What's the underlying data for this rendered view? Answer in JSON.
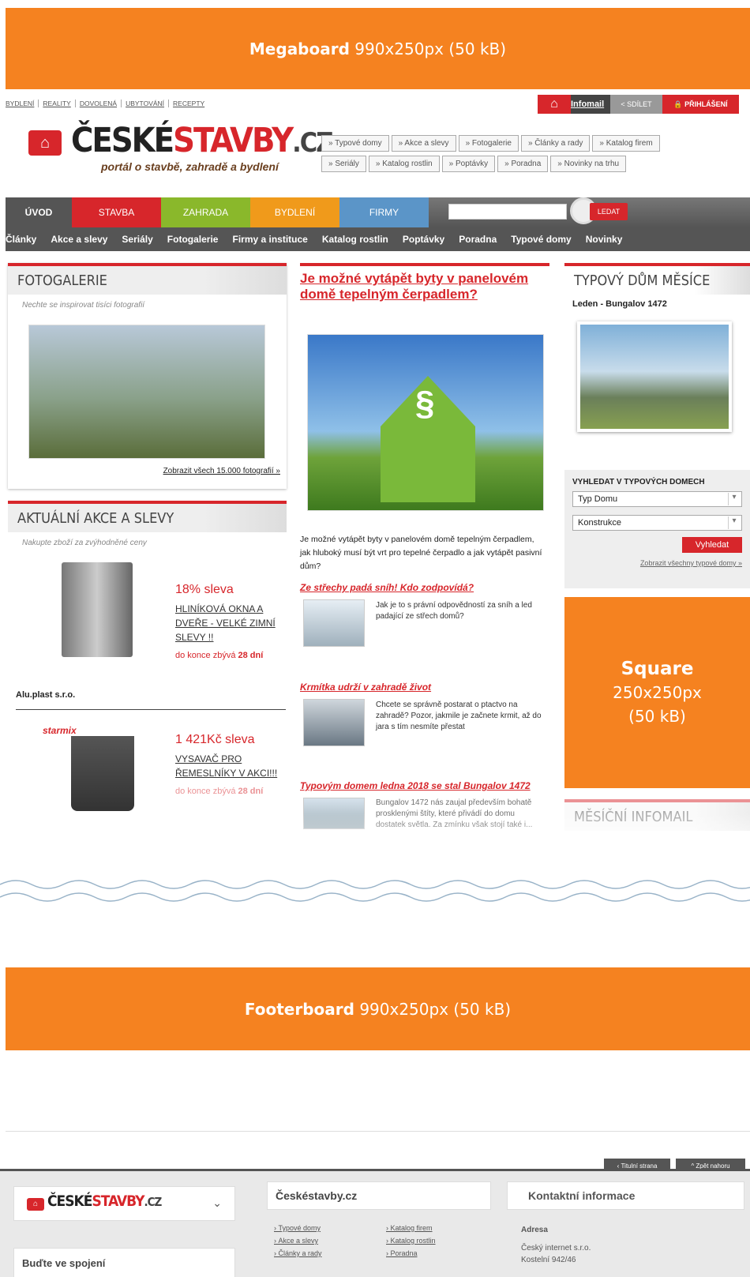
{
  "ads": {
    "mega": {
      "name": "Megaboard",
      "size": "990x250px (50 kB)"
    },
    "square": {
      "name": "Square",
      "size": "250x250px",
      "weight": "(50 kB)"
    },
    "foot": {
      "name": "Footerboard",
      "size": "990x250px (50 kB)"
    }
  },
  "toplinks": [
    "BYDLENÍ",
    "REALITY",
    "DOVOLENÁ",
    "UBYTOVÁNÍ",
    "RECEPTY"
  ],
  "topright": {
    "infomail": "Infomail",
    "share": "SDÍLET",
    "login": "PŘIHLÁŠENÍ"
  },
  "logo": {
    "a": "ČESKÉ",
    "b": "STAVBY",
    "c": ".CZ",
    "tagline": "portál o stavbě, zahradě a bydlení"
  },
  "quick": [
    "» Typové domy",
    "» Akce a slevy",
    "» Fotogalerie",
    "» Články a rady",
    "» Katalog firem",
    "» Seriály",
    "» Katalog rostlin",
    "» Poptávky",
    "» Poradna",
    "» Novinky na trhu"
  ],
  "mainnav": [
    {
      "label": "ÚVOD",
      "color": "#555555"
    },
    {
      "label": "STAVBA",
      "color": "#d7262b"
    },
    {
      "label": "ZAHRADA",
      "color": "#8ab82b"
    },
    {
      "label": "BYDLENÍ",
      "color": "#f09a1b"
    },
    {
      "label": "FIRMY",
      "color": "#5b95c8"
    }
  ],
  "search_button": "LEDAT",
  "subnav": [
    "Články",
    "Akce a slevy",
    "Seriály",
    "Fotogalerie",
    "Firmy a instituce",
    "Katalog rostlin",
    "Poptávky",
    "Poradna",
    "Typové domy",
    "Novinky"
  ],
  "gallery": {
    "title": "FOTOGALERIE",
    "sub": "Nechte se inspirovat tisíci fotografií",
    "link": "Zobrazit všech 15.000 fotografií »"
  },
  "deals": {
    "title": "AKTUÁLNÍ AKCE A SLEVY",
    "sub": "Nakupte zboží za zvýhodněné ceny",
    "items": [
      {
        "discount": "18% sleva",
        "name": "HLINÍKOVÁ OKNA A DVEŘE - VELKÉ ZIMNÍ SLEVY !!",
        "remaining": "do konce zbývá",
        "days": "28 dní",
        "company": "Alu.plast s.r.o."
      },
      {
        "discount": "1 421Kč sleva",
        "name": "VYSAVAČ PRO ŘEMESLNÍKY V AKCI!!!",
        "remaining": "do konce zbývá",
        "days": "28 dní",
        "brand": "starmix"
      }
    ]
  },
  "center": {
    "headline": "Je možné vytápět byty v panelovém domě tepelným čerpadlem?",
    "lead": "Je možné vytápět byty v panelovém domě tepelným čerpadlem, jak hluboký musí být vrt pro tepelné čerpadlo a jak vytápět pasivní dům?",
    "articles": [
      {
        "title": "Ze střechy padá sníh! Kdo zodpovídá?",
        "text": "Jak je to s právní odpovědností za sníh a led padající ze střech domů?"
      },
      {
        "title": "Krmítka udrží v zahradě život",
        "text": "Chcete se správně postarat o ptactvo na zahradě? Pozor, jakmile je začnete krmit, až do jara s tím nesmíte přestat"
      },
      {
        "title": "Typovým domem ledna 2018 se stal Bungalov 1472",
        "text": "Bungalov 1472 nás zaujal především bohatě prosklenými štíty, které přivádí do domu dostatek světla. Za zmínku však stojí také i..."
      }
    ]
  },
  "house": {
    "title": "TYPOVÝ DŮM MĚSÍCE",
    "name": "Leden - Bungalov 1472",
    "search_title": "VYHLEDAT V TYPOVÝCH DOMECH",
    "select1": "Typ Domu",
    "select2": "Konstrukce",
    "button": "Vyhledat",
    "link": "Zobrazit všechny typové domy »"
  },
  "infomail": {
    "title": "MĚSÍČNÍ INFOMAIL"
  },
  "footer": {
    "title_page": "Titulní strana",
    "top": "Zpět nahoru",
    "logo_a": "ČESKÉ",
    "logo_b": "STAVBY",
    "logo_c": ".CZ",
    "connect": "Buďte ve spojení",
    "col_title": "Českéstavby.cz",
    "links": [
      "Typové domy",
      "Katalog firem",
      "Akce a slevy",
      "Katalog rostlin",
      "Články a rady",
      "Poradna"
    ],
    "contact_title": "Kontaktní informace",
    "address_label": "Adresa",
    "company": "Český internet s.r.o.",
    "street": "Kostelní 942/46"
  }
}
